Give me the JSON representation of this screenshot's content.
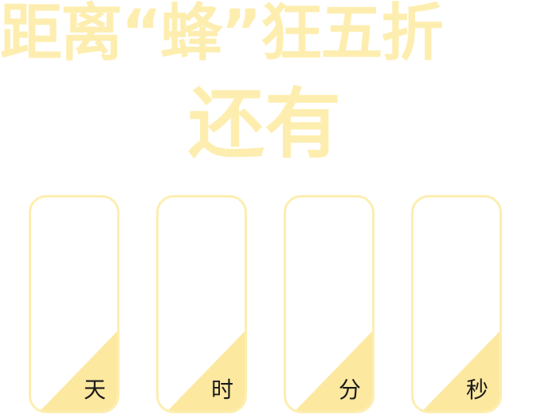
{
  "headline": {
    "line1": "距离“蜂”狂五折",
    "line2": "还有"
  },
  "countdown": {
    "units": [
      {
        "id": "days",
        "label": "天",
        "value": ""
      },
      {
        "id": "hours",
        "label": "时",
        "value": ""
      },
      {
        "id": "minutes",
        "label": "分",
        "value": ""
      },
      {
        "id": "seconds",
        "label": "秒",
        "value": ""
      }
    ]
  },
  "colors": {
    "accent": "#fdeeb0",
    "corner_fill": "#fde8a0",
    "label_text": "#1a1a1a"
  }
}
